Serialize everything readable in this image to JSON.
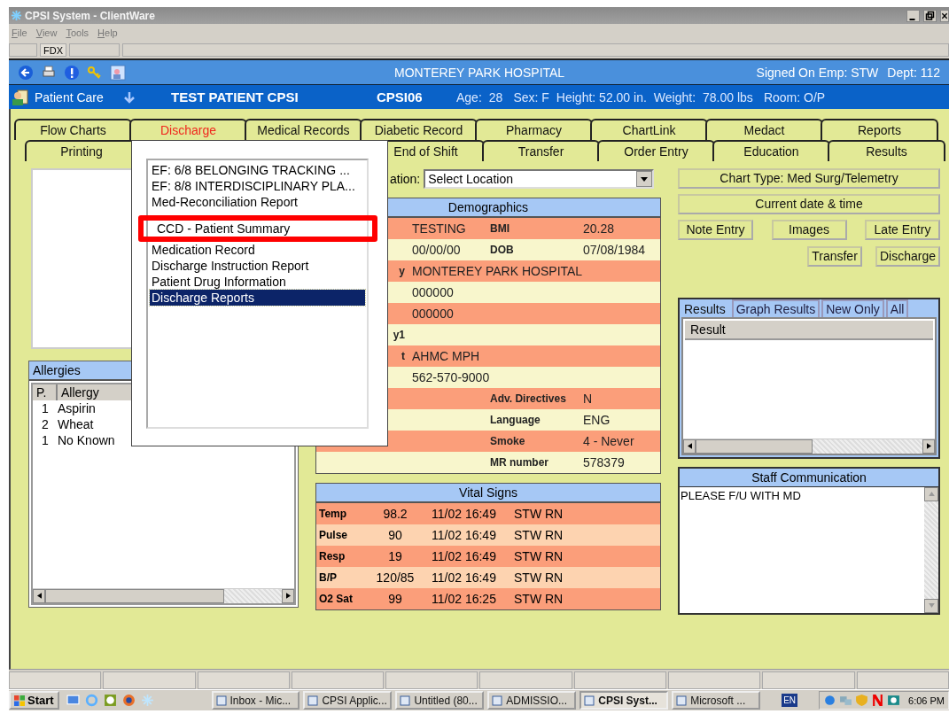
{
  "window": {
    "title": "CPSI System - ClientWare"
  },
  "menu": [
    "File",
    "View",
    "Tools",
    "Help"
  ],
  "toolbar_fields": [
    "FDX"
  ],
  "header": {
    "hospital": "MONTEREY PARK HOSPITAL",
    "signed_on": "Signed On Emp: STW",
    "dept": "Dept: 112"
  },
  "patient_bar": {
    "module": "Patient Care",
    "name": "TEST PATIENT CPSI",
    "id": "CPSI06",
    "fields": [
      {
        "label": "Age:",
        "value": "28"
      },
      {
        "label": "Sex: F"
      },
      {
        "label": "Height: 52.00 in."
      },
      {
        "label": "Weight:",
        "value": "78.00 lbs"
      },
      {
        "label": "Room: O/P"
      }
    ]
  },
  "tabs_row1": [
    {
      "label": "Flow Charts",
      "selected": false
    },
    {
      "label": "Discharge",
      "selected": true
    },
    {
      "label": "Medical Records",
      "selected": false
    },
    {
      "label": "Diabetic Record",
      "selected": false
    },
    {
      "label": "Pharmacy",
      "selected": false
    },
    {
      "label": "ChartLink",
      "selected": false
    },
    {
      "label": "Medact",
      "selected": false
    },
    {
      "label": "Reports",
      "selected": false
    }
  ],
  "tabs_row2": [
    {
      "label": "Printing",
      "selected": false
    },
    {
      "label": "End of Shift",
      "selected": false
    },
    {
      "label": "Transfer",
      "selected": false
    },
    {
      "label": "Order Entry",
      "selected": false
    },
    {
      "label": "Education",
      "selected": false
    },
    {
      "label": "Results",
      "selected": false
    }
  ],
  "allergies": {
    "title": "Allergies",
    "columns": [
      "P.",
      "Allergy"
    ],
    "rows": [
      {
        "p": "1",
        "allergy": "Aspirin"
      },
      {
        "p": "2",
        "allergy": "Wheat"
      },
      {
        "p": "1",
        "allergy": "No Known"
      }
    ]
  },
  "location": {
    "label": "ation:",
    "value": "Select Location"
  },
  "demographics": {
    "title": "Demographics",
    "rows": [
      {
        "value": "TESTING",
        "label2": "BMI",
        "value2": "20.28"
      },
      {
        "value": "00/00/00",
        "label2": "DOB",
        "value2": "07/08/1984"
      },
      {
        "label": "y",
        "value": "MONTEREY PARK HOSPITAL"
      },
      {
        "value": "000000"
      },
      {
        "value": "000000"
      },
      {
        "label": "y1"
      },
      {
        "label": "t",
        "value": "AHMC MPH"
      },
      {
        "value": "562-570-9000"
      },
      {
        "label2": "Adv. Directives",
        "value2": "N"
      },
      {
        "label2": "Language",
        "value2": "ENG"
      },
      {
        "label2": "Smoke",
        "value2": "4 - Never"
      },
      {
        "label2": "MR number",
        "value2": "578379"
      }
    ]
  },
  "vital_signs": {
    "title": "Vital Signs",
    "rows": [
      {
        "name": "Temp",
        "value": "98.2",
        "time": "11/02 16:49",
        "by": "STW RN"
      },
      {
        "name": "Pulse",
        "value": "90",
        "time": "11/02 16:49",
        "by": "STW RN"
      },
      {
        "name": "Resp",
        "value": "19",
        "time": "11/02 16:49",
        "by": "STW RN"
      },
      {
        "name": "B/P",
        "value": "120/85",
        "time": "11/02 16:49",
        "by": "STW RN"
      },
      {
        "name": "O2 Sat",
        "value": "99",
        "time": "11/02 16:25",
        "by": "STW RN"
      }
    ]
  },
  "side": {
    "chart_type": "Chart Type: Med Surg/Telemetry",
    "current_datetime": "Current date & time",
    "buttons": [
      "Note Entry",
      "Images",
      "Late Entry"
    ],
    "buttons2": [
      "Transfer",
      "Discharge"
    ]
  },
  "results": {
    "tabs": [
      {
        "label": "Results",
        "selected": true
      },
      {
        "label": "Graph Results",
        "selected": false
      },
      {
        "label": "New Only",
        "selected": false
      },
      {
        "label": "All",
        "selected": false
      }
    ],
    "column": "Result"
  },
  "staff_communication": {
    "title": "Staff Communication",
    "text": "PLEASE F/U WITH MD"
  },
  "discharge_menu": {
    "items": [
      {
        "label": "EF: 6/8 BELONGING TRACKING ...",
        "selected": false,
        "highlighted": false
      },
      {
        "label": "EF: 8/8 INTERDISCIPLINARY PLA...",
        "selected": false,
        "highlighted": false
      },
      {
        "label": "Med-Reconciliation Report",
        "selected": false,
        "highlighted": false
      },
      {
        "label": "CCD - Patient Summary",
        "selected": false,
        "highlighted": true
      },
      {
        "label": "Medication Record",
        "selected": false,
        "highlighted": false
      },
      {
        "label": "Discharge Instruction Report",
        "selected": false,
        "highlighted": false
      },
      {
        "label": "Patient Drug Information",
        "selected": false,
        "highlighted": false
      },
      {
        "label": "Discharge Reports",
        "selected": true,
        "highlighted": false
      }
    ]
  },
  "taskbar": {
    "start": "Start",
    "tasks": [
      {
        "label": "Inbox - Mic...",
        "selected": false
      },
      {
        "label": "CPSI Applic...",
        "selected": false
      },
      {
        "label": "Untitled (80...",
        "selected": false
      },
      {
        "label": "ADMISSIO...",
        "selected": false
      },
      {
        "label": "CPSI Syst...",
        "selected": true
      },
      {
        "label": "Microsoft ...",
        "selected": false
      }
    ],
    "language": "EN",
    "clock": "6:06 PM"
  }
}
